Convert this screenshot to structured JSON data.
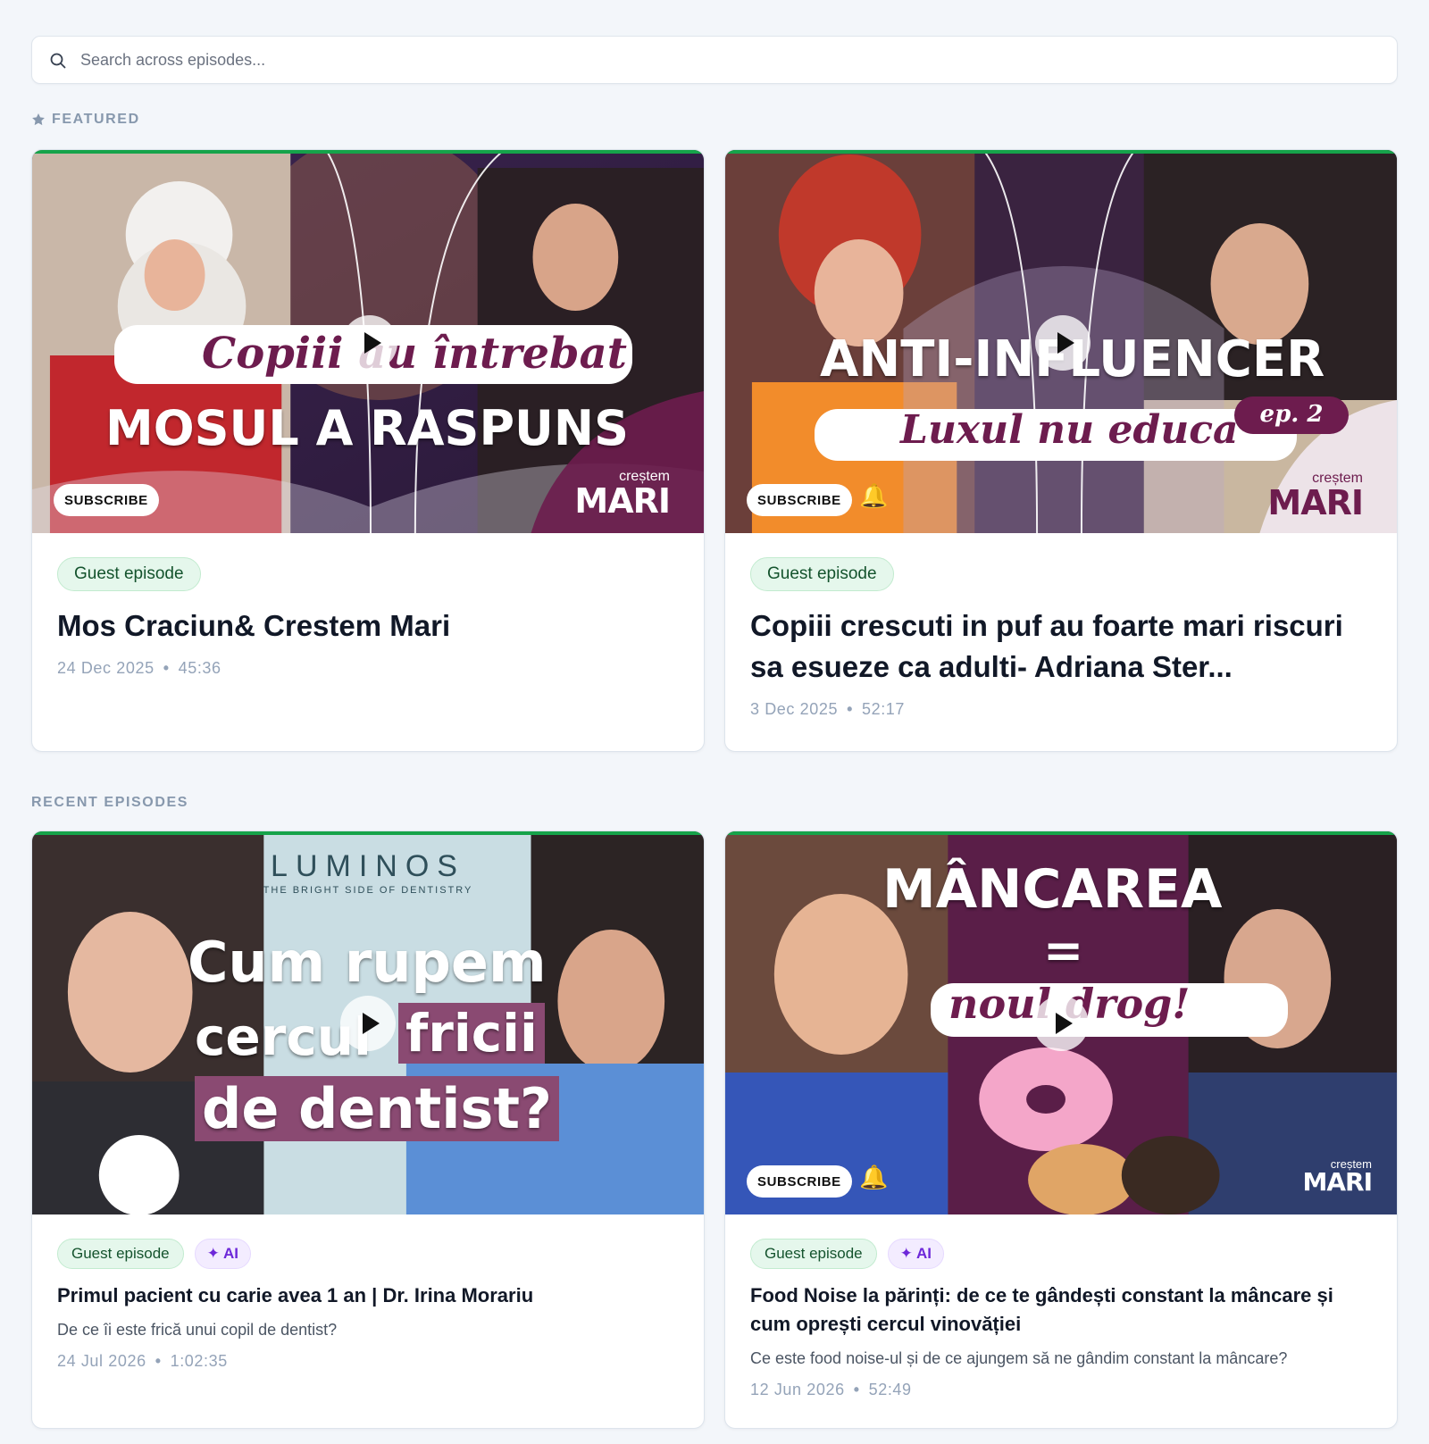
{
  "search": {
    "placeholder": "Search across episodes..."
  },
  "featured": {
    "label": "FEATURED",
    "episodes": [
      {
        "thumb_text": {
          "script": "Copiii au întrebat",
          "headline": "MOSUL A RASPUNS",
          "subscribe": "SUBSCRIBE",
          "brand_small": "creștem",
          "brand_big": "MARI"
        },
        "badge": "Guest episode",
        "title": "Mos Craciun& Crestem Mari",
        "date": "24 Dec 2025",
        "duration": "45:36"
      },
      {
        "thumb_text": {
          "headline": "ANTI-INFLUENCER",
          "script": "Luxul nu educa",
          "tag": "ep. 2",
          "subscribe": "SUBSCRIBE",
          "brand_small": "creștem",
          "brand_big": "MARI"
        },
        "badge": "Guest episode",
        "title": "Copiii crescuti in puf au foarte mari riscuri sa esueze ca adulti- Adriana Ster...",
        "date": "3 Dec 2025",
        "duration": "52:17"
      }
    ]
  },
  "recent": {
    "label": "RECENT EPISODES",
    "episodes": [
      {
        "thumb_text": {
          "logo": "LUMINOS",
          "logo_sub": "THE BRIGHT SIDE OF DENTISTRY",
          "line1": "Cum rupem",
          "line2a": "cercul",
          "line2b": "fricii",
          "line3": "de dentist?"
        },
        "badge": "Guest episode",
        "ai_badge": "✦ AI",
        "title": "Primul pacient cu carie avea 1 an | Dr. Irina Morariu",
        "description": "De ce îi este frică unui copil de dentist?",
        "date": "24 Jul 2026",
        "duration": "1:02:35"
      },
      {
        "thumb_text": {
          "line1": "MÂNCAREA",
          "line2": "=",
          "script": "noul drog!",
          "subscribe": "SUBSCRIBE",
          "brand_small": "creștem",
          "brand_big": "MARI"
        },
        "badge": "Guest episode",
        "ai_badge": "✦ AI",
        "title": "Food Noise la părinți: de ce te gândești constant la mâncare și cum oprești cercul vinovăției",
        "description": "Ce este food noise-ul și de ce ajungem să ne gândim constant la mâncare?",
        "date": "12 Jun 2026",
        "duration": "52:49"
      }
    ]
  },
  "colors": {
    "accent_green": "#16a34a",
    "brand_plum": "#6d1c4e",
    "ai_purple": "#6d28d9"
  }
}
